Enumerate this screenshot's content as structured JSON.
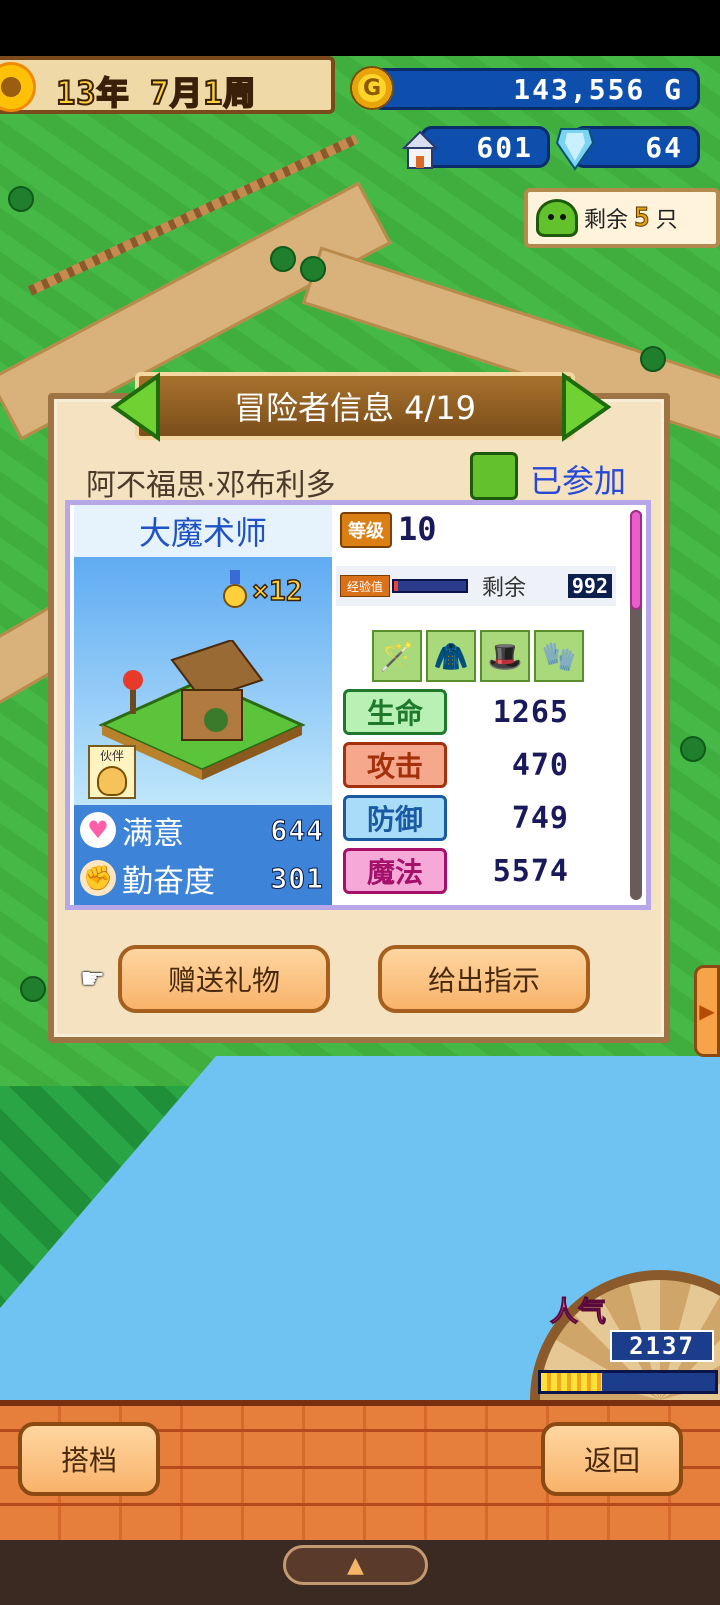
{
  "top_bar": {
    "date_year": "13",
    "date_year_unit": "年",
    "date_month": "7",
    "date_month_unit": "月",
    "date_week": "1",
    "date_week_unit": "周",
    "coin_symbol": "G",
    "gold": "143,556 G",
    "houses": "601",
    "crystals": "64"
  },
  "remaining": {
    "label": "剩余",
    "value": "5",
    "unit": "只"
  },
  "panel": {
    "title": "冒险者信息 4/19",
    "hero_name": "阿不福思·邓布利多",
    "status": "已参加"
  },
  "hero": {
    "class": "大魔术师",
    "medal_count": "×12",
    "partner_label": "伙伴",
    "level_tag": "等级",
    "level": "10",
    "exp_tag": "经验值",
    "exp_fill": 0.05,
    "exp_remain_label": "剩余",
    "exp_remain": "992",
    "satisfaction_label": "满意",
    "satisfaction": "644",
    "diligence_label": "勤奋度",
    "diligence": "301"
  },
  "equipment": [
    {
      "icon": "staff-icon",
      "glyph": "🪄"
    },
    {
      "icon": "robe-icon",
      "glyph": "🧥"
    },
    {
      "icon": "hat-icon",
      "glyph": "🎩"
    },
    {
      "icon": "gauntlet-icon",
      "glyph": "🧤"
    }
  ],
  "stats": [
    {
      "label": "生命",
      "value": "1265",
      "bg": "#b9f0b4",
      "fg": "#1e7a2a"
    },
    {
      "label": "攻击",
      "value": "470",
      "bg": "#f6a88c",
      "fg": "#a4300e"
    },
    {
      "label": "防御",
      "value": "749",
      "bg": "#a9dcf6",
      "fg": "#1a5aa4"
    },
    {
      "label": "魔法",
      "value": "5574",
      "bg": "#f6a8d8",
      "fg": "#a4106a"
    }
  ],
  "actions": {
    "gift": "赠送礼物",
    "instruct": "给出指示"
  },
  "popularity": {
    "label": "人气",
    "value": "2137",
    "fill": 0.35
  },
  "footer": {
    "partner_btn": "搭档",
    "back_btn": "返回"
  },
  "colors": {
    "accent_blue": "#0e4fae",
    "panel_bg": "#f4e2c0",
    "button_orange": "#f8b36a"
  }
}
